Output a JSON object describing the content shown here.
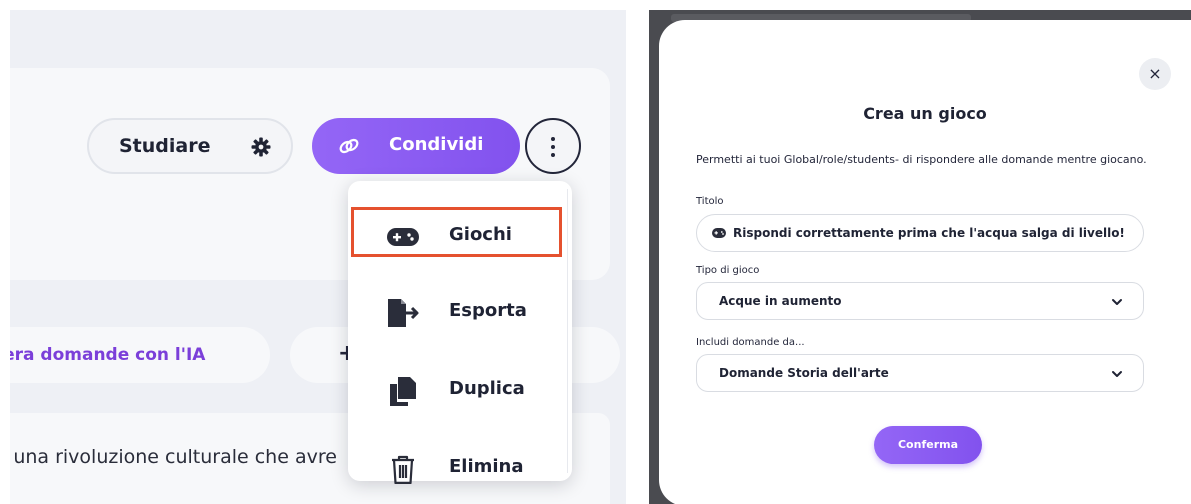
{
  "left_panel": {
    "header": {
      "studiare_label": "Studiare",
      "condividi_label": "Condividi"
    },
    "dropdown_menu": {
      "items": [
        {
          "label": "Giochi",
          "icon": "gamepad-icon",
          "highlighted": true
        },
        {
          "label": "Esporta",
          "icon": "export-file-icon",
          "highlighted": false
        },
        {
          "label": "Duplica",
          "icon": "duplicate-icon",
          "highlighted": false
        },
        {
          "label": "Elimina",
          "icon": "trash-icon",
          "highlighted": false
        }
      ]
    },
    "actions": {
      "ai_label": "nera domande con l'IA",
      "add_label": "+"
    },
    "question_preview": "i una rivoluzione culturale che avre"
  },
  "modal": {
    "title": "Crea un gioco",
    "description": "Permetti ai tuoi Global/role/students- di rispondere alle domande mentre giocano.",
    "fields": {
      "titolo": {
        "label": "Titolo",
        "value": "Rispondi correttamente prima che l'acqua salga di livello!"
      },
      "tipo_di_gioco": {
        "label": "Tipo di gioco",
        "value": "Acque in aumento"
      },
      "includi_domande": {
        "label": "Includi domande da...",
        "value": "Domande Storia dell'arte"
      }
    },
    "confirm_label": "Conferma",
    "close_label": "×"
  },
  "colors": {
    "accent": "#8b5cf6",
    "highlight_border": "#e5512e",
    "ai_text": "#7b3fd9",
    "overlay": "#4a4b50"
  }
}
